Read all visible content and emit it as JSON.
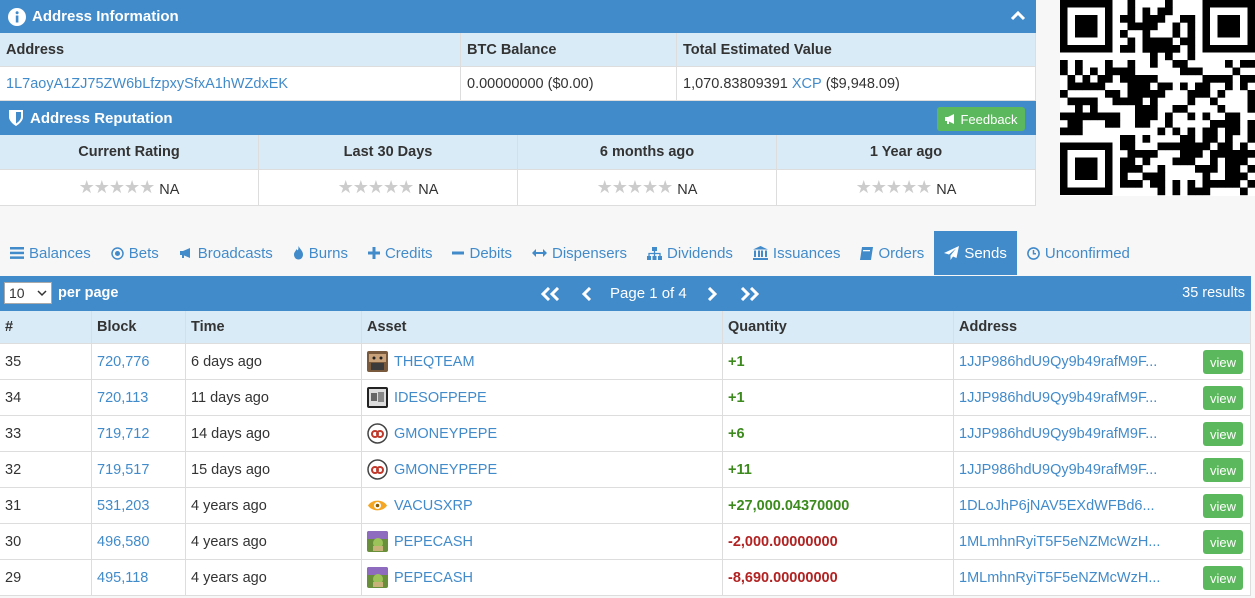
{
  "address_info": {
    "title": "Address Information",
    "headers": [
      "Address",
      "BTC Balance",
      "Total Estimated Value"
    ],
    "address": "1L7aoyA1ZJ75ZW6bLfzpxySfxA1hWZdxEK",
    "btc_balance": "0.00000000 ($0.00)",
    "total_value_amount": "1,070.83809391",
    "total_value_asset": "XCP",
    "total_value_usd": "($9,948.09)"
  },
  "reputation": {
    "title": "Address Reputation",
    "feedback_label": "Feedback",
    "headers": [
      "Current Rating",
      "Last 30 Days",
      "6 months ago",
      "1 Year ago"
    ],
    "values": [
      "NA",
      "NA",
      "NA",
      "NA"
    ]
  },
  "tabs": [
    {
      "label": "Balances",
      "icon": "list-icon"
    },
    {
      "label": "Bets",
      "icon": "target-icon"
    },
    {
      "label": "Broadcasts",
      "icon": "bullhorn-icon"
    },
    {
      "label": "Burns",
      "icon": "fire-icon"
    },
    {
      "label": "Credits",
      "icon": "plus-icon"
    },
    {
      "label": "Debits",
      "icon": "minus-icon"
    },
    {
      "label": "Dispensers",
      "icon": "arrows-h-icon"
    },
    {
      "label": "Dividends",
      "icon": "sitemap-icon"
    },
    {
      "label": "Issuances",
      "icon": "bank-icon"
    },
    {
      "label": "Orders",
      "icon": "book-icon"
    },
    {
      "label": "Sends",
      "icon": "paper-plane-icon",
      "active": true
    },
    {
      "label": "Unconfirmed",
      "icon": "clock-icon"
    }
  ],
  "pager": {
    "per_page_value": "10",
    "per_page_label": "per page",
    "page_text": "Page 1 of 4",
    "results": "35 results"
  },
  "table": {
    "headers": [
      "#",
      "Block",
      "Time",
      "Asset",
      "Quantity",
      "Address"
    ],
    "view_label": "view",
    "rows": [
      {
        "num": "35",
        "block": "720,776",
        "time": "6 days ago",
        "asset": "THEQTEAM",
        "icon": "theqteam-icon",
        "qty": "+1",
        "address": "1JJP986hdU9Qy9b49rafM9F..."
      },
      {
        "num": "34",
        "block": "720,113",
        "time": "11 days ago",
        "asset": "IDESOFPEPE",
        "icon": "idesofpepe-icon",
        "qty": "+1",
        "address": "1JJP986hdU9Qy9b49rafM9F..."
      },
      {
        "num": "33",
        "block": "719,712",
        "time": "14 days ago",
        "asset": "GMONEYPEPE",
        "icon": "gmoneypepe-icon",
        "qty": "+6",
        "address": "1JJP986hdU9Qy9b49rafM9F..."
      },
      {
        "num": "32",
        "block": "719,517",
        "time": "15 days ago",
        "asset": "GMONEYPEPE",
        "icon": "gmoneypepe-icon",
        "qty": "+11",
        "address": "1JJP986hdU9Qy9b49rafM9F..."
      },
      {
        "num": "31",
        "block": "531,203",
        "time": "4 years ago",
        "asset": "VACUSXRP",
        "icon": "vacusxrp-icon",
        "qty": "+27,000.04370000",
        "address": "1DLoJhP6jNAV5EXdWFBd6..."
      },
      {
        "num": "30",
        "block": "496,580",
        "time": "4 years ago",
        "asset": "PEPECASH",
        "icon": "pepecash-icon",
        "qty": "-2,000.00000000",
        "address": "1MLmhnRyiT5F5eNZMcWzH..."
      },
      {
        "num": "29",
        "block": "495,118",
        "time": "4 years ago",
        "asset": "PEPECASH",
        "icon": "pepecash-icon",
        "qty": "-8,690.00000000",
        "address": "1MLmhnRyiT5F5eNZMcWzH..."
      }
    ]
  },
  "colors": {
    "primary": "#428bca",
    "header_bg": "#d9ebf7",
    "success": "#5cb85c",
    "positive": "#3c8a1e",
    "negative": "#b22222"
  }
}
